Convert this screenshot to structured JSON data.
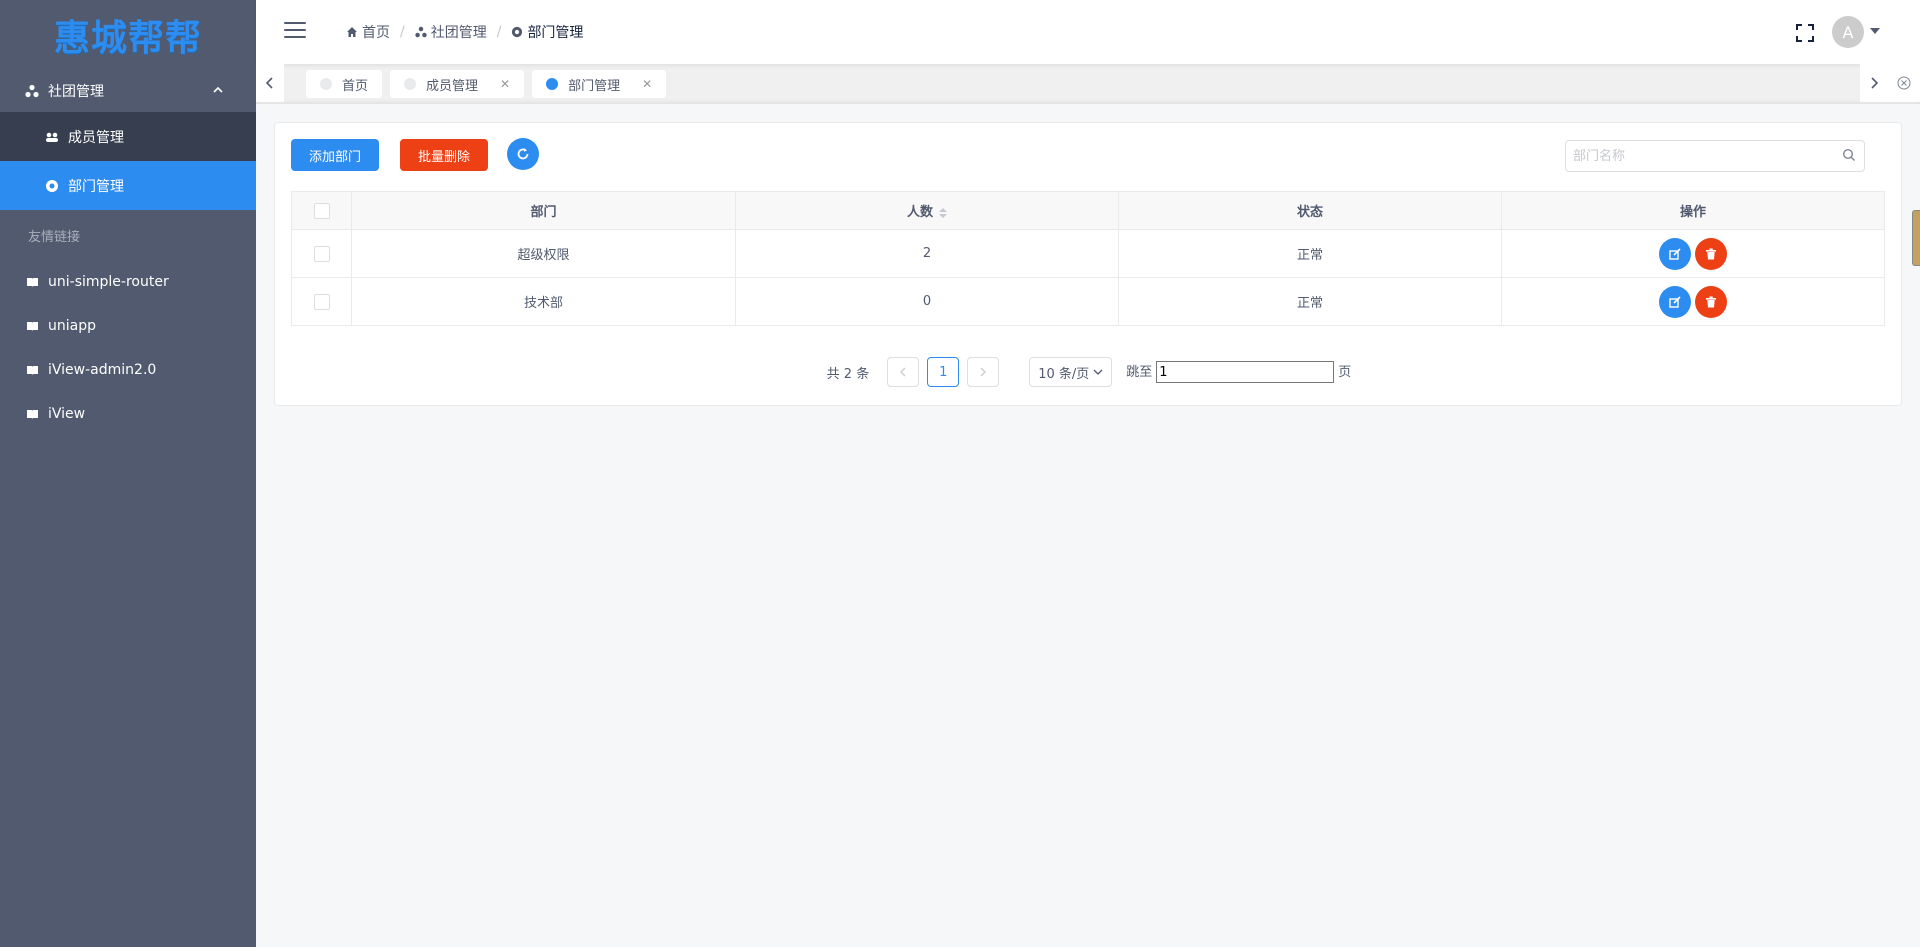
{
  "sidebar": {
    "logo": "惠城帮帮",
    "group": {
      "label": "社团管理",
      "icon": "cluster-icon"
    },
    "sub_items": [
      {
        "label": "成员管理",
        "icon": "people-icon",
        "active": false
      },
      {
        "label": "部门管理",
        "icon": "circle-icon",
        "active": true
      }
    ],
    "section_label": "友情链接",
    "links": [
      {
        "label": "uni-simple-router",
        "icon": "book-icon"
      },
      {
        "label": "uniapp",
        "icon": "book-icon"
      },
      {
        "label": "iView-admin2.0",
        "icon": "book-icon"
      },
      {
        "label": "iView",
        "icon": "book-icon"
      }
    ]
  },
  "header": {
    "breadcrumb": [
      {
        "label": "首页",
        "icon": "home-icon"
      },
      {
        "label": "社团管理",
        "icon": "cluster-icon"
      },
      {
        "label": "部门管理",
        "icon": "circle-icon"
      }
    ],
    "avatar_letter": "A"
  },
  "tags": [
    {
      "label": "首页",
      "closable": false,
      "active": false
    },
    {
      "label": "成员管理",
      "closable": true,
      "active": false
    },
    {
      "label": "部门管理",
      "closable": true,
      "active": true
    }
  ],
  "toolbar": {
    "add_label": "添加部门",
    "batch_delete_label": "批量删除",
    "search_placeholder": "部门名称"
  },
  "table": {
    "headers": {
      "dept": "部门",
      "count": "人数",
      "status": "状态",
      "ops": "操作"
    },
    "rows": [
      {
        "dept": "超级权限",
        "count": "2",
        "status": "正常"
      },
      {
        "dept": "技术部",
        "count": "0",
        "status": "正常"
      }
    ]
  },
  "pagination": {
    "total_text": "共 2 条",
    "current_page": "1",
    "page_size": "10 条/页",
    "jump_label": "跳至",
    "jump_value": "1",
    "page_suffix": "页"
  },
  "colors": {
    "primary": "#2d8cf0",
    "danger": "#ed4014",
    "sidebar_bg": "#515a6e",
    "sidebar_sub_bg": "#363e4f"
  }
}
